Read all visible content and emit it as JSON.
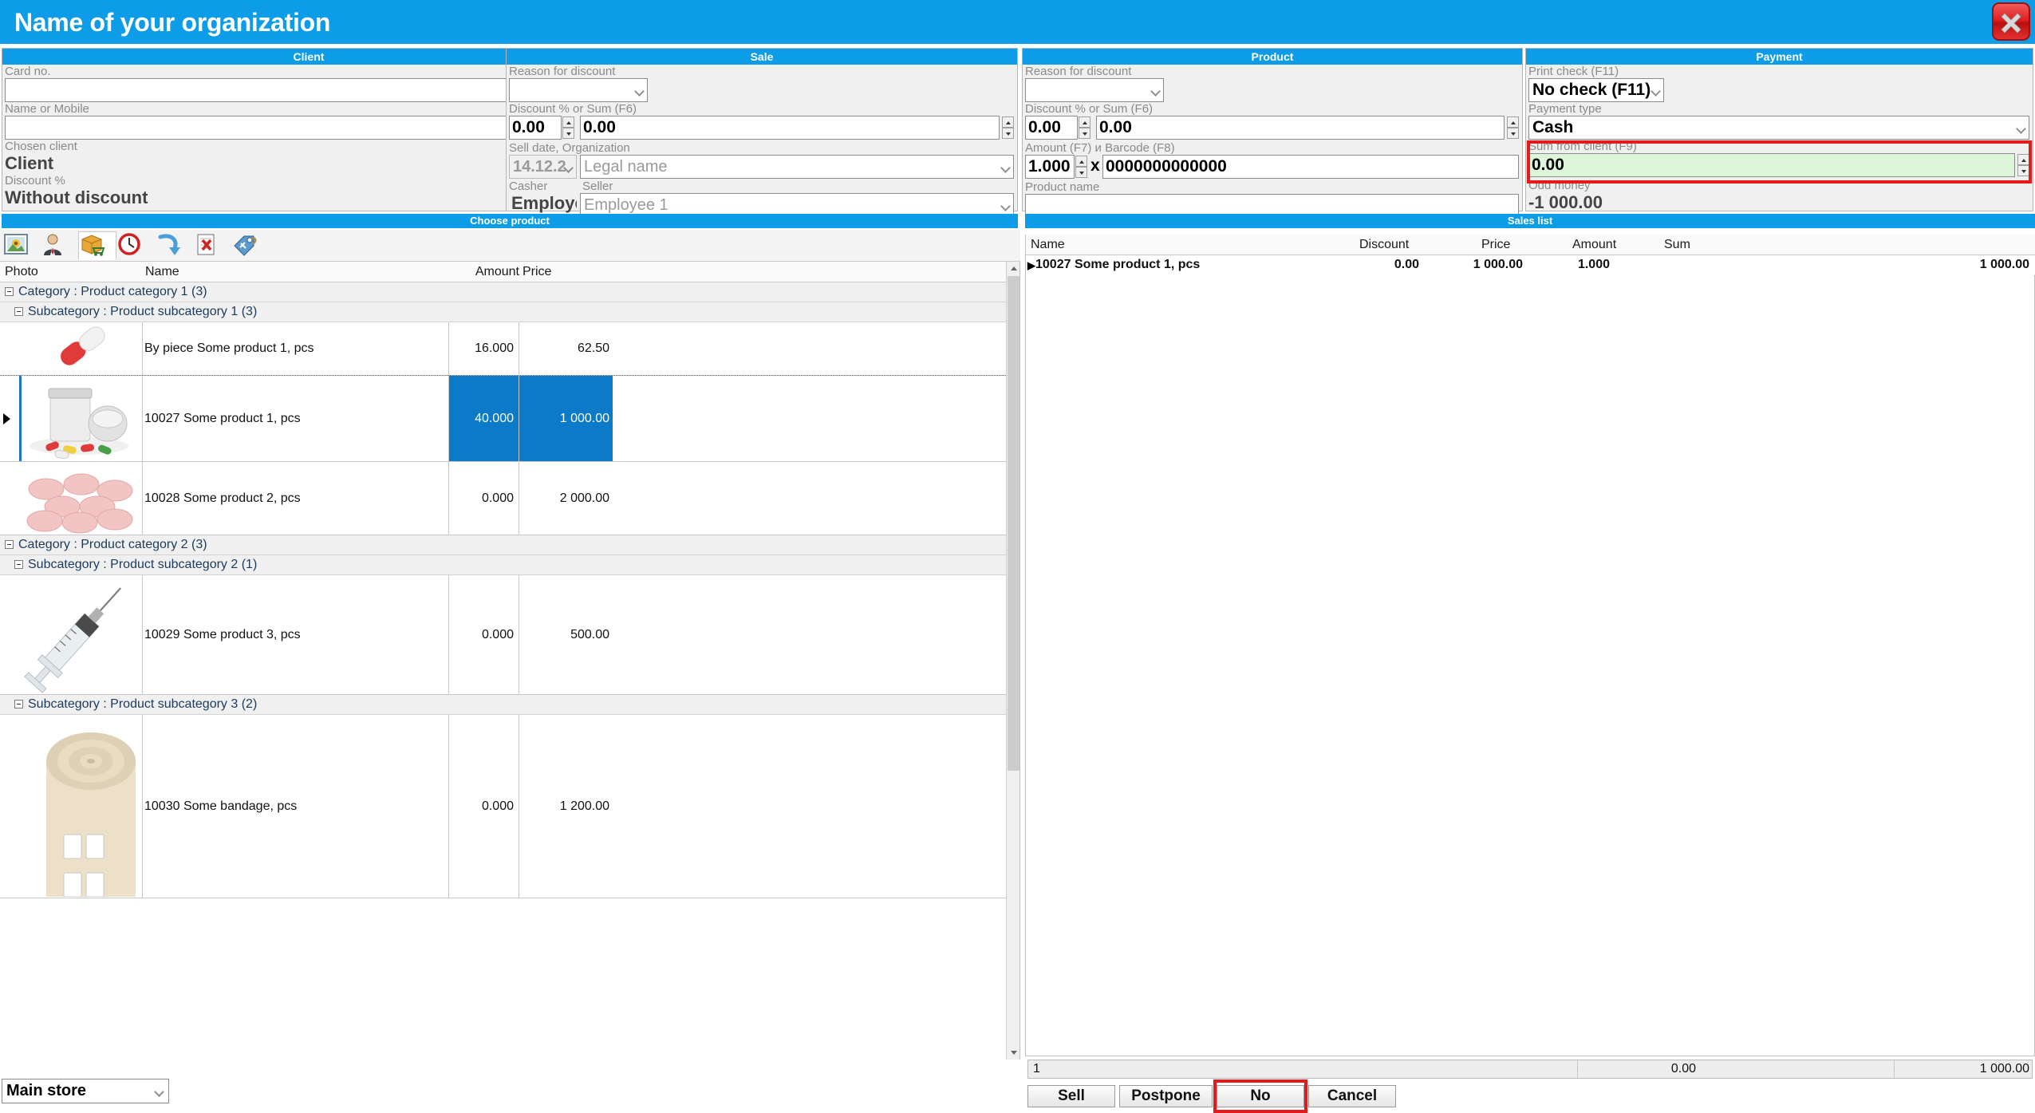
{
  "window": {
    "title": "Name of your organization",
    "close_icon": "close-icon",
    "accent_blue": "#0d9ce8",
    "highlight_red": "#e51b1b",
    "selection_blue": "#0b7ac8"
  },
  "client_panel": {
    "header": "Client",
    "card_no_label": "Card no.",
    "card_no_value": "",
    "name_mobile_label": "Name or Mobile",
    "name_mobile_value": "",
    "chosen_client_label": "Chosen client",
    "chosen_client_value": "Client",
    "discount_label": "Discount %",
    "discount_value": "Without discount"
  },
  "sale_panel": {
    "header": "Sale",
    "reason_label": "Reason for discount",
    "reason_value": "",
    "discount_label": "Discount % or Sum (F6)",
    "discount_percent": "0.00",
    "discount_sum": "0.00",
    "selldate_label": "Sell date, Organization",
    "selldate_value": "14.12.2",
    "organization_value": "Legal name",
    "casher_label": "Casher",
    "casher_value": "Employee",
    "seller_label": "Seller",
    "seller_value": "Employee 1"
  },
  "product_panel": {
    "header": "Product",
    "reason_label": "Reason for discount",
    "reason_value": "",
    "discount_label": "Discount % or Sum (F6)",
    "discount_percent": "0.00",
    "discount_sum": "0.00",
    "amount_barcode_label": "Amount (F7) и Barcode (F8)",
    "amount_value": "1.000",
    "multiply_sign": "x",
    "barcode_value": "0000000000000",
    "product_name_label": "Product name",
    "product_name_value": ""
  },
  "payment_panel": {
    "header": "Payment",
    "print_check_label": "Print check (F11)",
    "print_check_value": "No check (F11)",
    "payment_type_label": "Payment type",
    "payment_type_value": "Cash",
    "sum_from_client_label": "Sum from client (F9)",
    "sum_from_client_value": "0.00",
    "odd_money_label": "Odd money",
    "odd_money_value": "-1 000.00"
  },
  "choose_product": {
    "header": "Choose product",
    "toolbar": [
      {
        "name": "photo-icon",
        "selected": false
      },
      {
        "name": "client-person-icon",
        "selected": false
      },
      {
        "name": "product-box-cart-icon",
        "selected": true
      },
      {
        "name": "clock-history-icon",
        "selected": false
      },
      {
        "name": "return-arrow-icon",
        "selected": false
      },
      {
        "name": "cancel-document-icon",
        "selected": false
      },
      {
        "name": "price-tag-icon",
        "selected": false
      }
    ],
    "columns": [
      "Photo",
      "Name",
      "Amount",
      "Price"
    ],
    "rows": [
      {
        "kind": "category",
        "label": "Category : Product category 1 (3)"
      },
      {
        "kind": "subcategory",
        "label": "Subcategory : Product subcategory 1 (3)"
      },
      {
        "kind": "product",
        "photo": "pill-capsule-photo",
        "name": "By piece Some product 1, pcs",
        "amount": "16.000",
        "price": "62.50",
        "selected": false
      },
      {
        "kind": "product",
        "photo": "pill-bottle-photo",
        "name": "10027 Some product 1, pcs",
        "amount": "40.000",
        "price": "1 000.00",
        "selected": true
      },
      {
        "kind": "product",
        "photo": "pink-tablets-photo",
        "name": "10028 Some product 2, pcs",
        "amount": "0.000",
        "price": "2 000.00",
        "selected": false
      },
      {
        "kind": "category",
        "label": "Category : Product category 2 (3)"
      },
      {
        "kind": "subcategory",
        "label": "Subcategory : Product subcategory 2 (1)"
      },
      {
        "kind": "product",
        "photo": "syringe-photo",
        "name": "10029 Some product 3, pcs",
        "amount": "0.000",
        "price": "500.00",
        "selected": false
      },
      {
        "kind": "subcategory",
        "label": "Subcategory : Product subcategory 3 (2)"
      },
      {
        "kind": "product",
        "photo": "bandage-photo",
        "name": "10030 Some bandage, pcs",
        "amount": "0.000",
        "price": "1 200.00",
        "selected": false
      }
    ]
  },
  "sales_list": {
    "header": "Sales list",
    "columns": [
      "Name",
      "Discount",
      "Price",
      "Amount",
      "Sum"
    ],
    "rows": [
      {
        "name": "10027 Some product 1, pcs",
        "discount": "0.00",
        "price": "1 000.00",
        "amount": "1.000",
        "sum": "1 000.00"
      }
    ],
    "totals": {
      "count": "1",
      "discount": "0.00",
      "sum": "1 000.00"
    }
  },
  "footer": {
    "sell_label": "Sell",
    "postpone_label": "Postpone",
    "no_label": "No",
    "cancel_label": "Cancel",
    "store_value": "Main store"
  }
}
